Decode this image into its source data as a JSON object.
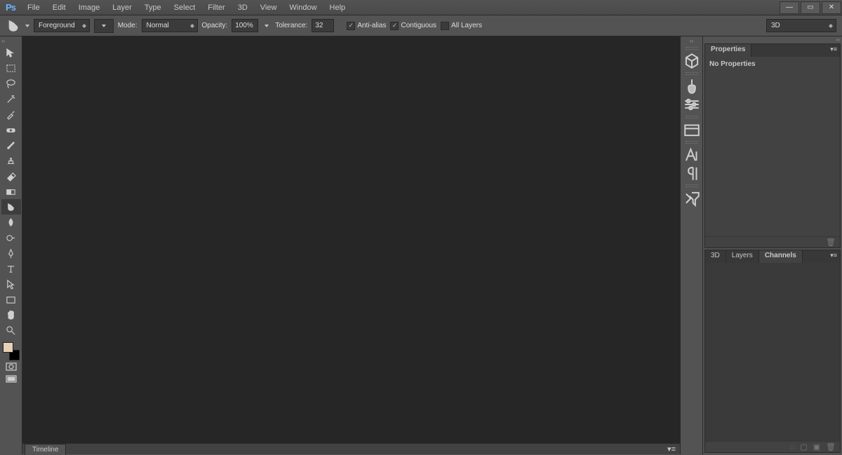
{
  "app": {
    "logo": "Ps"
  },
  "menu": {
    "items": [
      "File",
      "Edit",
      "Image",
      "Layer",
      "Type",
      "Select",
      "Filter",
      "3D",
      "View",
      "Window",
      "Help"
    ]
  },
  "options": {
    "fill_source": "Foreground",
    "mode_label": "Mode:",
    "mode_value": "Normal",
    "opacity_label": "Opacity:",
    "opacity_value": "100%",
    "tolerance_label": "Tolerance:",
    "tolerance_value": "32",
    "antialias_label": "Anti-alias",
    "contiguous_label": "Contiguous",
    "all_layers_label": "All Layers",
    "workspace": "3D"
  },
  "swatch": {
    "fg": "#e9d1b7",
    "bg": "#000000"
  },
  "properties": {
    "tab": "Properties",
    "body": "No Properties"
  },
  "layers_panel": {
    "tabs": [
      "3D",
      "Layers",
      "Channels"
    ],
    "active": 2
  },
  "timeline": {
    "tab": "Timeline"
  }
}
